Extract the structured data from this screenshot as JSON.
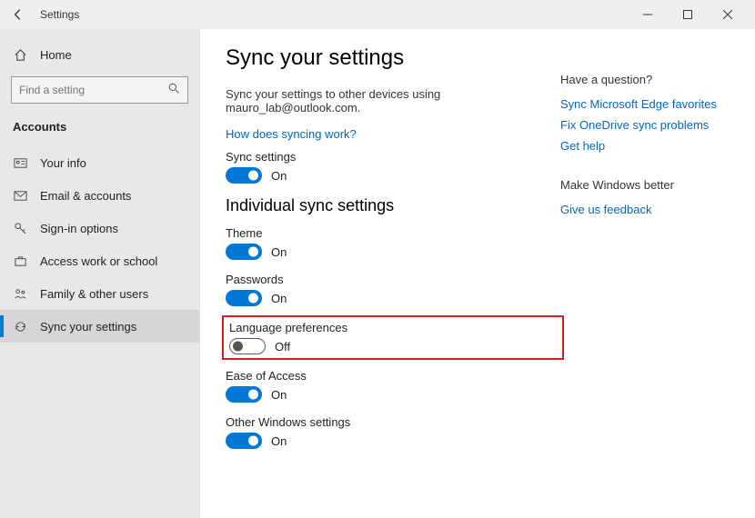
{
  "titlebar": {
    "title": "Settings"
  },
  "sidebar": {
    "home": "Home",
    "search_placeholder": "Find a setting",
    "section": "Accounts",
    "items": [
      {
        "label": "Your info"
      },
      {
        "label": "Email & accounts"
      },
      {
        "label": "Sign-in options"
      },
      {
        "label": "Access work or school"
      },
      {
        "label": "Family & other users"
      },
      {
        "label": "Sync your settings"
      }
    ]
  },
  "main": {
    "heading": "Sync your settings",
    "description": "Sync your settings to other devices using mauro_lab@outlook.com.",
    "how_link": "How does syncing work?",
    "sync_settings": {
      "label": "Sync settings",
      "state": "On"
    },
    "individual_heading": "Individual sync settings",
    "settings": [
      {
        "label": "Theme",
        "state": "On"
      },
      {
        "label": "Passwords",
        "state": "On"
      },
      {
        "label": "Language preferences",
        "state": "Off",
        "highlighted": true
      },
      {
        "label": "Ease of Access",
        "state": "On"
      },
      {
        "label": "Other Windows settings",
        "state": "On"
      }
    ]
  },
  "right": {
    "question_heading": "Have a question?",
    "links": [
      "Sync Microsoft Edge favorites",
      "Fix OneDrive sync problems",
      "Get help"
    ],
    "better_heading": "Make Windows better",
    "feedback_link": "Give us feedback"
  }
}
